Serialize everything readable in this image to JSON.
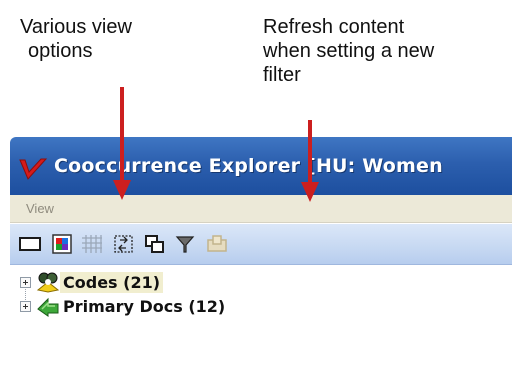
{
  "annotations": {
    "left_lines": [
      "Various view",
      "options"
    ],
    "right_lines": [
      "Refresh content",
      "when setting a new",
      "filter"
    ],
    "arrow_color": "#cc1f1f"
  },
  "window": {
    "title": "Cooccurrence Explorer  [HU: Women",
    "menu": [
      "View"
    ],
    "toolbar_icons": [
      "single-pane-view-icon",
      "color-matrix-view-icon",
      "grid-table-view-icon",
      "import-arrows-icon",
      "duplicate-windows-icon",
      "filter-funnel-icon",
      "disabled-export-icon"
    ],
    "tree": [
      {
        "label": "Codes (21)",
        "icon": "codes-icon",
        "selected": true
      },
      {
        "label": "Primary Docs (12)",
        "icon": "primary-docs-icon",
        "selected": false
      }
    ]
  },
  "colors": {
    "title_bar": "#2c5fae",
    "toolbar": "#c6d8f2",
    "menubar": "#ece9d8"
  }
}
